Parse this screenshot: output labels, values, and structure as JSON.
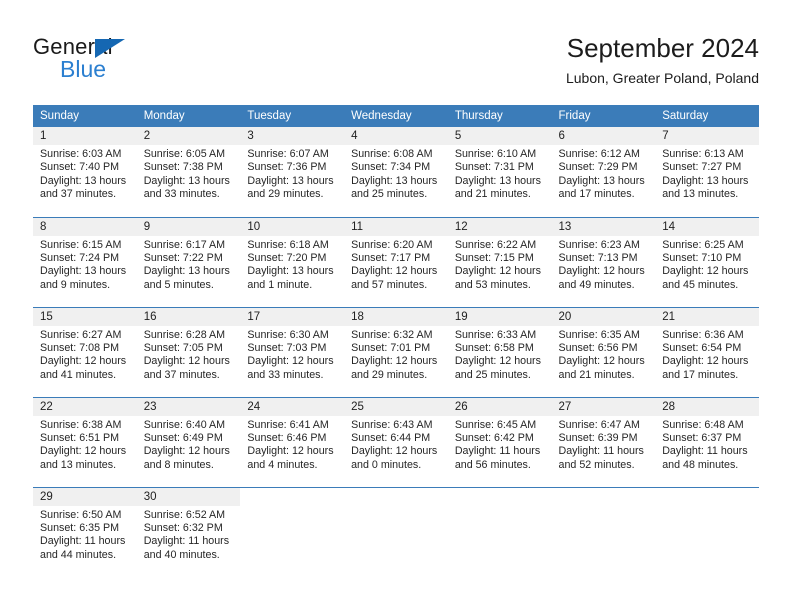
{
  "brand": {
    "name_top": "General",
    "name_bottom": "Blue",
    "triangle_color": "#1567b2",
    "blue_text_color": "#2b7fd0"
  },
  "header": {
    "title": "September 2024",
    "subtitle": "Lubon, Greater Poland, Poland",
    "accent_color": "#3b7cb9",
    "daynum_band_color": "#f0f0f0"
  },
  "calendar": {
    "weekday_headers": [
      "Sunday",
      "Monday",
      "Tuesday",
      "Wednesday",
      "Thursday",
      "Friday",
      "Saturday"
    ],
    "weeks": [
      [
        {
          "day": "1",
          "sunrise": "Sunrise: 6:03 AM",
          "sunset": "Sunset: 7:40 PM",
          "daylight_line1": "Daylight: 13 hours",
          "daylight_line2": "and 37 minutes."
        },
        {
          "day": "2",
          "sunrise": "Sunrise: 6:05 AM",
          "sunset": "Sunset: 7:38 PM",
          "daylight_line1": "Daylight: 13 hours",
          "daylight_line2": "and 33 minutes."
        },
        {
          "day": "3",
          "sunrise": "Sunrise: 6:07 AM",
          "sunset": "Sunset: 7:36 PM",
          "daylight_line1": "Daylight: 13 hours",
          "daylight_line2": "and 29 minutes."
        },
        {
          "day": "4",
          "sunrise": "Sunrise: 6:08 AM",
          "sunset": "Sunset: 7:34 PM",
          "daylight_line1": "Daylight: 13 hours",
          "daylight_line2": "and 25 minutes."
        },
        {
          "day": "5",
          "sunrise": "Sunrise: 6:10 AM",
          "sunset": "Sunset: 7:31 PM",
          "daylight_line1": "Daylight: 13 hours",
          "daylight_line2": "and 21 minutes."
        },
        {
          "day": "6",
          "sunrise": "Sunrise: 6:12 AM",
          "sunset": "Sunset: 7:29 PM",
          "daylight_line1": "Daylight: 13 hours",
          "daylight_line2": "and 17 minutes."
        },
        {
          "day": "7",
          "sunrise": "Sunrise: 6:13 AM",
          "sunset": "Sunset: 7:27 PM",
          "daylight_line1": "Daylight: 13 hours",
          "daylight_line2": "and 13 minutes."
        }
      ],
      [
        {
          "day": "8",
          "sunrise": "Sunrise: 6:15 AM",
          "sunset": "Sunset: 7:24 PM",
          "daylight_line1": "Daylight: 13 hours",
          "daylight_line2": "and 9 minutes."
        },
        {
          "day": "9",
          "sunrise": "Sunrise: 6:17 AM",
          "sunset": "Sunset: 7:22 PM",
          "daylight_line1": "Daylight: 13 hours",
          "daylight_line2": "and 5 minutes."
        },
        {
          "day": "10",
          "sunrise": "Sunrise: 6:18 AM",
          "sunset": "Sunset: 7:20 PM",
          "daylight_line1": "Daylight: 13 hours",
          "daylight_line2": "and 1 minute."
        },
        {
          "day": "11",
          "sunrise": "Sunrise: 6:20 AM",
          "sunset": "Sunset: 7:17 PM",
          "daylight_line1": "Daylight: 12 hours",
          "daylight_line2": "and 57 minutes."
        },
        {
          "day": "12",
          "sunrise": "Sunrise: 6:22 AM",
          "sunset": "Sunset: 7:15 PM",
          "daylight_line1": "Daylight: 12 hours",
          "daylight_line2": "and 53 minutes."
        },
        {
          "day": "13",
          "sunrise": "Sunrise: 6:23 AM",
          "sunset": "Sunset: 7:13 PM",
          "daylight_line1": "Daylight: 12 hours",
          "daylight_line2": "and 49 minutes."
        },
        {
          "day": "14",
          "sunrise": "Sunrise: 6:25 AM",
          "sunset": "Sunset: 7:10 PM",
          "daylight_line1": "Daylight: 12 hours",
          "daylight_line2": "and 45 minutes."
        }
      ],
      [
        {
          "day": "15",
          "sunrise": "Sunrise: 6:27 AM",
          "sunset": "Sunset: 7:08 PM",
          "daylight_line1": "Daylight: 12 hours",
          "daylight_line2": "and 41 minutes."
        },
        {
          "day": "16",
          "sunrise": "Sunrise: 6:28 AM",
          "sunset": "Sunset: 7:05 PM",
          "daylight_line1": "Daylight: 12 hours",
          "daylight_line2": "and 37 minutes."
        },
        {
          "day": "17",
          "sunrise": "Sunrise: 6:30 AM",
          "sunset": "Sunset: 7:03 PM",
          "daylight_line1": "Daylight: 12 hours",
          "daylight_line2": "and 33 minutes."
        },
        {
          "day": "18",
          "sunrise": "Sunrise: 6:32 AM",
          "sunset": "Sunset: 7:01 PM",
          "daylight_line1": "Daylight: 12 hours",
          "daylight_line2": "and 29 minutes."
        },
        {
          "day": "19",
          "sunrise": "Sunrise: 6:33 AM",
          "sunset": "Sunset: 6:58 PM",
          "daylight_line1": "Daylight: 12 hours",
          "daylight_line2": "and 25 minutes."
        },
        {
          "day": "20",
          "sunrise": "Sunrise: 6:35 AM",
          "sunset": "Sunset: 6:56 PM",
          "daylight_line1": "Daylight: 12 hours",
          "daylight_line2": "and 21 minutes."
        },
        {
          "day": "21",
          "sunrise": "Sunrise: 6:36 AM",
          "sunset": "Sunset: 6:54 PM",
          "daylight_line1": "Daylight: 12 hours",
          "daylight_line2": "and 17 minutes."
        }
      ],
      [
        {
          "day": "22",
          "sunrise": "Sunrise: 6:38 AM",
          "sunset": "Sunset: 6:51 PM",
          "daylight_line1": "Daylight: 12 hours",
          "daylight_line2": "and 13 minutes."
        },
        {
          "day": "23",
          "sunrise": "Sunrise: 6:40 AM",
          "sunset": "Sunset: 6:49 PM",
          "daylight_line1": "Daylight: 12 hours",
          "daylight_line2": "and 8 minutes."
        },
        {
          "day": "24",
          "sunrise": "Sunrise: 6:41 AM",
          "sunset": "Sunset: 6:46 PM",
          "daylight_line1": "Daylight: 12 hours",
          "daylight_line2": "and 4 minutes."
        },
        {
          "day": "25",
          "sunrise": "Sunrise: 6:43 AM",
          "sunset": "Sunset: 6:44 PM",
          "daylight_line1": "Daylight: 12 hours",
          "daylight_line2": "and 0 minutes."
        },
        {
          "day": "26",
          "sunrise": "Sunrise: 6:45 AM",
          "sunset": "Sunset: 6:42 PM",
          "daylight_line1": "Daylight: 11 hours",
          "daylight_line2": "and 56 minutes."
        },
        {
          "day": "27",
          "sunrise": "Sunrise: 6:47 AM",
          "sunset": "Sunset: 6:39 PM",
          "daylight_line1": "Daylight: 11 hours",
          "daylight_line2": "and 52 minutes."
        },
        {
          "day": "28",
          "sunrise": "Sunrise: 6:48 AM",
          "sunset": "Sunset: 6:37 PM",
          "daylight_line1": "Daylight: 11 hours",
          "daylight_line2": "and 48 minutes."
        }
      ],
      [
        {
          "day": "29",
          "sunrise": "Sunrise: 6:50 AM",
          "sunset": "Sunset: 6:35 PM",
          "daylight_line1": "Daylight: 11 hours",
          "daylight_line2": "and 44 minutes."
        },
        {
          "day": "30",
          "sunrise": "Sunrise: 6:52 AM",
          "sunset": "Sunset: 6:32 PM",
          "daylight_line1": "Daylight: 11 hours",
          "daylight_line2": "and 40 minutes."
        },
        {
          "day": "",
          "sunrise": "",
          "sunset": "",
          "daylight_line1": "",
          "daylight_line2": ""
        },
        {
          "day": "",
          "sunrise": "",
          "sunset": "",
          "daylight_line1": "",
          "daylight_line2": ""
        },
        {
          "day": "",
          "sunrise": "",
          "sunset": "",
          "daylight_line1": "",
          "daylight_line2": ""
        },
        {
          "day": "",
          "sunrise": "",
          "sunset": "",
          "daylight_line1": "",
          "daylight_line2": ""
        },
        {
          "day": "",
          "sunrise": "",
          "sunset": "",
          "daylight_line1": "",
          "daylight_line2": ""
        }
      ]
    ]
  }
}
